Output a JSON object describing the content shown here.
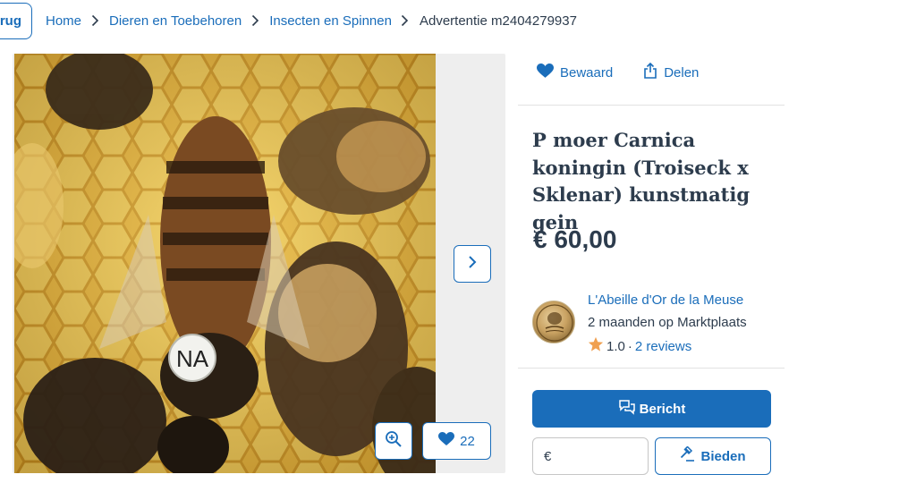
{
  "breadcrumb": {
    "back_label": "rug",
    "items": [
      {
        "label": "Home"
      },
      {
        "label": "Dieren en Toebehoren"
      },
      {
        "label": "Insecten en Spinnen"
      }
    ],
    "current": "Advertentie m2404279937"
  },
  "gallery": {
    "photo_tag_text": "NA",
    "likes_count": "22"
  },
  "actions": {
    "save_label": "Bewaard",
    "share_label": "Delen"
  },
  "listing": {
    "title": "P moer Carnica koningin (Troiseck x Sklenar) kunstmatig gein",
    "price": "€ 60,00"
  },
  "seller": {
    "name": "L'Abeille d'Or de la Meuse",
    "since": "2 maanden op Marktplaats",
    "rating": "1.0",
    "rating_sep": "·",
    "reviews": "2 reviews"
  },
  "contact": {
    "message_label": "Bericht",
    "bid_currency": "€",
    "bid_value": "",
    "bid_label": "Bieden"
  },
  "colors": {
    "accent": "#1a6dba",
    "text": "#2d3c4d",
    "star": "#f0a050"
  }
}
